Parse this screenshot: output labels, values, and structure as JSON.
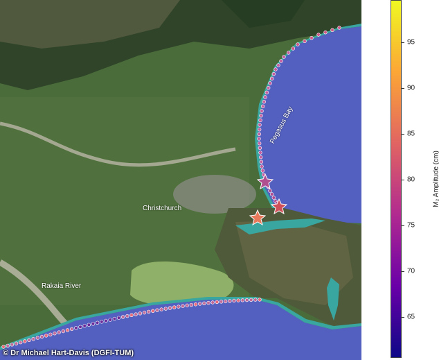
{
  "map": {
    "labels": {
      "city": "Christchurch",
      "river": "Rakaia River",
      "bay": "Pegasus Bay"
    },
    "credit": "© Dr Michael Hart-Davis (DGFI-TUM)"
  },
  "colorbar": {
    "label": "M₂ Amplitude (cm)",
    "ticks": [
      "95",
      "90",
      "85",
      "80",
      "75",
      "70",
      "65"
    ],
    "colormap": "plasma",
    "colors": [
      "#0d0887",
      "#6a00a8",
      "#b12a90",
      "#e16462",
      "#fca636",
      "#f0f921"
    ]
  },
  "colors": {
    "sea": "#5360c0",
    "coast_shallow": "#3aa6a0",
    "land": "#3f5f33",
    "lake": "#8fb068"
  },
  "markers": {
    "type": "star",
    "count": 3
  }
}
